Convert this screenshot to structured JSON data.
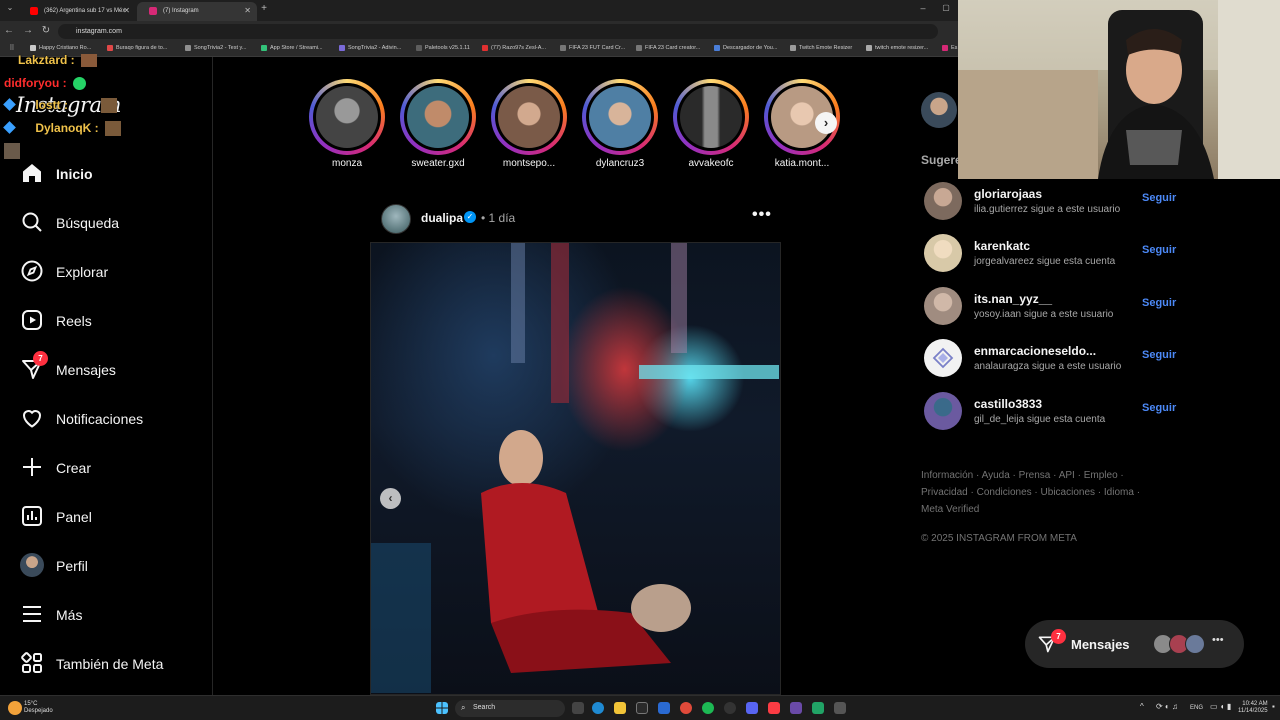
{
  "browser": {
    "tabs": [
      {
        "label": "(362) Argentina sub 17 vs Méx",
        "color": "#ff0000"
      },
      {
        "label": "(7) Instagram",
        "color": "#d62976"
      }
    ],
    "url": "instagram.com",
    "bookmarks": [
      "Happy Cristiano Ro...",
      "Buraqo figura de to...",
      "SongTrivia2 - Test y...",
      "App Store / Streami...",
      "SongTrivia2 - Adivin...",
      "Paletools v25.1.11",
      "(77) Razo97s Zesl-A...",
      "FIFA 23 FUT Card Cr...",
      "FIFA 23 Card creator...",
      "Descargador de You...",
      "Twitch Emote Resizer",
      "twitch emote resizer...",
      "Es"
    ]
  },
  "chat": [
    {
      "user": "Lakztard :",
      "color": "#f0c24a"
    },
    {
      "user": "didforyou :",
      "color": "#ff2d2d"
    },
    {
      "user": "lostt :",
      "color": "#f0c24a"
    },
    {
      "user": "DylanoqK :",
      "color": "#f0c24a"
    }
  ],
  "logo": "Instagram",
  "sidebar": {
    "items": [
      {
        "label": "Inicio",
        "icon": "home-icon"
      },
      {
        "label": "Búsqueda",
        "icon": "search-icon"
      },
      {
        "label": "Explorar",
        "icon": "explore-compass-icon"
      },
      {
        "label": "Reels",
        "icon": "reels-icon"
      },
      {
        "label": "Mensajes",
        "icon": "messenger-icon",
        "badge": "7"
      },
      {
        "label": "Notificaciones",
        "icon": "heart-icon"
      },
      {
        "label": "Crear",
        "icon": "plus-icon"
      },
      {
        "label": "Panel",
        "icon": "dashboard-icon"
      },
      {
        "label": "Perfil",
        "icon": "profile-avatar"
      },
      {
        "label": "Más",
        "icon": "menu-icon"
      },
      {
        "label": "También de Meta",
        "icon": "meta-apps-icon"
      }
    ]
  },
  "stories": [
    {
      "name": "monza",
      "color": "#6d6d6d"
    },
    {
      "name": "sweater.gxd",
      "color": "#3d6c7c"
    },
    {
      "name": "montsepo...",
      "color": "#7a5a48"
    },
    {
      "name": "dylancruz3",
      "color": "#4f7fa4"
    },
    {
      "name": "avvakeofc",
      "color": "#585858"
    },
    {
      "name": "katia.mont...",
      "color": "#b89a83"
    }
  ],
  "post": {
    "username": "dualipa",
    "time": "• 1 día"
  },
  "suggestions": {
    "header": "Sugere",
    "follow_label": "Seguir",
    "items": [
      {
        "username": "gloriarojaas",
        "subtitle": "ilia.gutierrez sigue a este usuario",
        "color": "#7d6a5e"
      },
      {
        "username": "karenkatc",
        "subtitle": "jorgealvareez sigue esta cuenta",
        "color": "#d8c9a8"
      },
      {
        "username": "its.nan_yyz__",
        "subtitle": "yosoy.iaan sigue a este usuario",
        "color": "#a08c80"
      },
      {
        "username": "enmarcacioneseldo...",
        "subtitle": "analauragza sigue a este usuario",
        "color": "#f2f2f2"
      },
      {
        "username": "castillo3833",
        "subtitle": "gil_de_leija sigue esta cuenta",
        "color": "#6b5aa0"
      }
    ]
  },
  "footer": {
    "links": [
      "Información",
      "Ayuda",
      "Prensa",
      "API",
      "Empleo",
      "Privacidad",
      "Condiciones",
      "Ubicaciones",
      "Idioma",
      "Meta Verified"
    ],
    "copyright": "© 2025 INSTAGRAM FROM META"
  },
  "messages_pill": {
    "label": "Mensajes",
    "badge": "7"
  },
  "taskbar": {
    "weather_temp": "15°C",
    "weather_desc": "Despejado",
    "search": "Search",
    "lang": "ENG",
    "time": "10:42 AM",
    "date": "11/14/2025"
  }
}
